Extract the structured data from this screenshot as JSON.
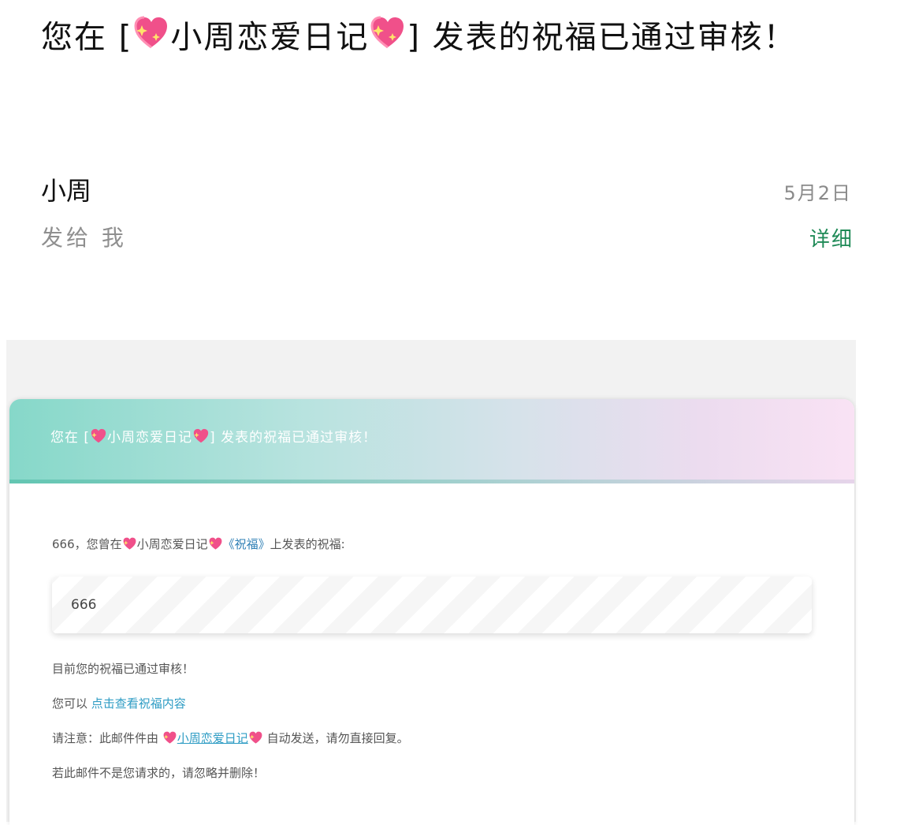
{
  "email": {
    "subject_prefix": "您在 [",
    "subject_site": "小周恋爱日记",
    "subject_suffix": "] 发表的祝福已通过审核！",
    "sender": "小周",
    "date": "5月2日",
    "recipient": "发给 我",
    "details_label": "详细"
  },
  "card": {
    "header_prefix": "您在 [",
    "header_site": "小周恋爱日记",
    "header_suffix": "] 发表的祝福已通过审核！",
    "intro_prefix": "666，您曾在",
    "intro_site": "小周恋爱日记",
    "intro_link": "《祝福》",
    "intro_suffix": "上发表的祝福:",
    "quote": "666",
    "approved_line": "目前您的祝福已通过审核！",
    "view_prefix": "您可以 ",
    "view_link": "点击查看祝福内容",
    "notice_prefix": "请注意：此邮件件由 ",
    "notice_site": "小周恋爱日记",
    "notice_suffix": " 自动发送，请勿直接回复。",
    "ignore_line": "若此邮件不是您请求的，请忽略并删除！"
  },
  "icons": {
    "heart": "sparkling-heart-icon"
  },
  "colors": {
    "details": "#1f8a57",
    "link": "#2e9cc4",
    "header_gradient_start": "#86d8c9",
    "header_gradient_end": "#f9e2f4",
    "heart_pink": "#f0508a"
  }
}
